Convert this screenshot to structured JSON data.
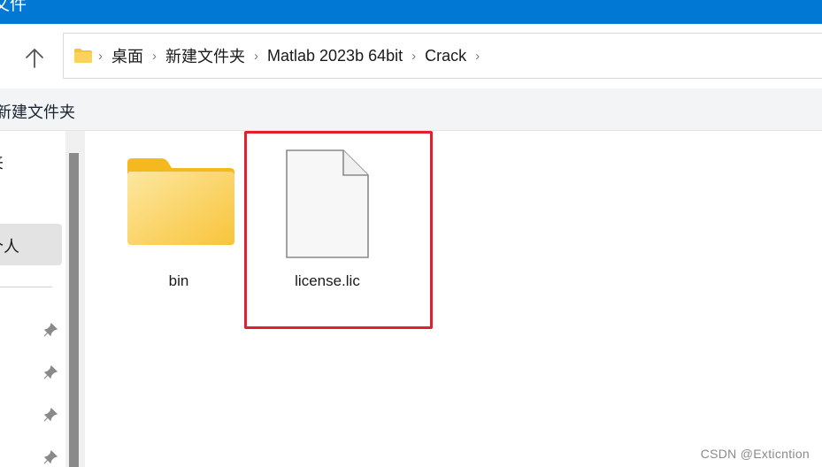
{
  "window": {
    "title": "文件"
  },
  "toolbar": {
    "up_icon": "arrow-up-icon"
  },
  "address_bar": {
    "root_icon": "folder-icon",
    "breadcrumbs": [
      "桌面",
      "新建文件夹",
      "Matlab 2023b 64bit",
      "Crack"
    ],
    "separator_icon": "chevron-right-icon"
  },
  "command_bar": {
    "new_folder_label": "新建文件夹"
  },
  "sidebar": {
    "items": [
      {
        "label": "夹"
      },
      {
        "label": "个人",
        "selected": true
      }
    ],
    "pinned_icons": [
      "pin-icon",
      "pin-icon",
      "pin-icon",
      "pin-icon"
    ]
  },
  "files": [
    {
      "name": "bin",
      "type": "folder",
      "icon": "folder-icon"
    },
    {
      "name": "license.lic",
      "type": "file",
      "icon": "file-icon",
      "highlighted": true
    }
  ],
  "colors": {
    "title_bar": "#0078d4",
    "highlight": "#e0202e",
    "folder": "#f9c844"
  },
  "watermark": "CSDN @Exticntion"
}
